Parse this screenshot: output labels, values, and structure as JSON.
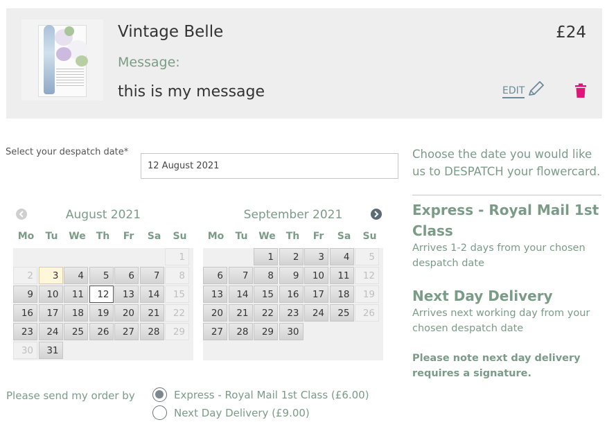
{
  "product": {
    "name": "Vintage Belle",
    "price": "£24",
    "message_label": "Message:",
    "message_text": "this is my message",
    "edit_label": "EDIT"
  },
  "despatch": {
    "label": "Select your despatch date*",
    "value": "12 August 2021"
  },
  "calendar": {
    "weekdays": [
      "Mo",
      "Tu",
      "We",
      "Th",
      "Fr",
      "Sa",
      "Su"
    ],
    "months": [
      {
        "title": "August 2021",
        "weeks": [
          [
            "",
            "",
            "",
            "",
            "",
            "",
            "1"
          ],
          [
            "2",
            "3",
            "4",
            "5",
            "6",
            "7",
            "8"
          ],
          [
            "9",
            "10",
            "11",
            "12",
            "13",
            "14",
            "15"
          ],
          [
            "16",
            "17",
            "18",
            "19",
            "20",
            "21",
            "22"
          ],
          [
            "23",
            "24",
            "25",
            "26",
            "27",
            "28",
            "29"
          ],
          [
            "30",
            "31",
            "",
            "",
            "",
            "",
            ""
          ]
        ],
        "disabled_days": [
          "1",
          "2",
          "8",
          "15",
          "22",
          "29",
          "30"
        ],
        "today": "3",
        "selected": "12"
      },
      {
        "title": "September 2021",
        "weeks": [
          [
            "",
            "",
            "1",
            "2",
            "3",
            "4",
            "5"
          ],
          [
            "6",
            "7",
            "8",
            "9",
            "10",
            "11",
            "12"
          ],
          [
            "13",
            "14",
            "15",
            "16",
            "17",
            "18",
            "19"
          ],
          [
            "20",
            "21",
            "22",
            "23",
            "24",
            "25",
            "26"
          ],
          [
            "27",
            "28",
            "29",
            "30",
            "",
            "",
            ""
          ],
          [
            "",
            "",
            "",
            "",
            "",
            "",
            ""
          ]
        ],
        "disabled_days": [
          "5",
          "12",
          "19",
          "26"
        ],
        "today": "",
        "selected": ""
      }
    ]
  },
  "delivery": {
    "label": "Please send my order by",
    "options": [
      {
        "label": "Express - Royal Mail 1st Class (£6.00)",
        "selected": true
      },
      {
        "label": "Next Day Delivery (£9.00)",
        "selected": false
      }
    ]
  },
  "info": {
    "intro": "Choose the date you would like us to DESPATCH your flowercard.",
    "express_title": "Express - Royal Mail 1st Class",
    "express_desc": "Arrives 1-2 days from your chosen despatch date",
    "nextday_title": "Next Day Delivery",
    "nextday_desc": "Arrives next working day from your chosen despatch date",
    "note": "Please note next day delivery requires a signature."
  },
  "colors": {
    "accent_green": "#7a9c87",
    "delete_pink": "#e0157a",
    "card_bg": "#eeeeee"
  }
}
